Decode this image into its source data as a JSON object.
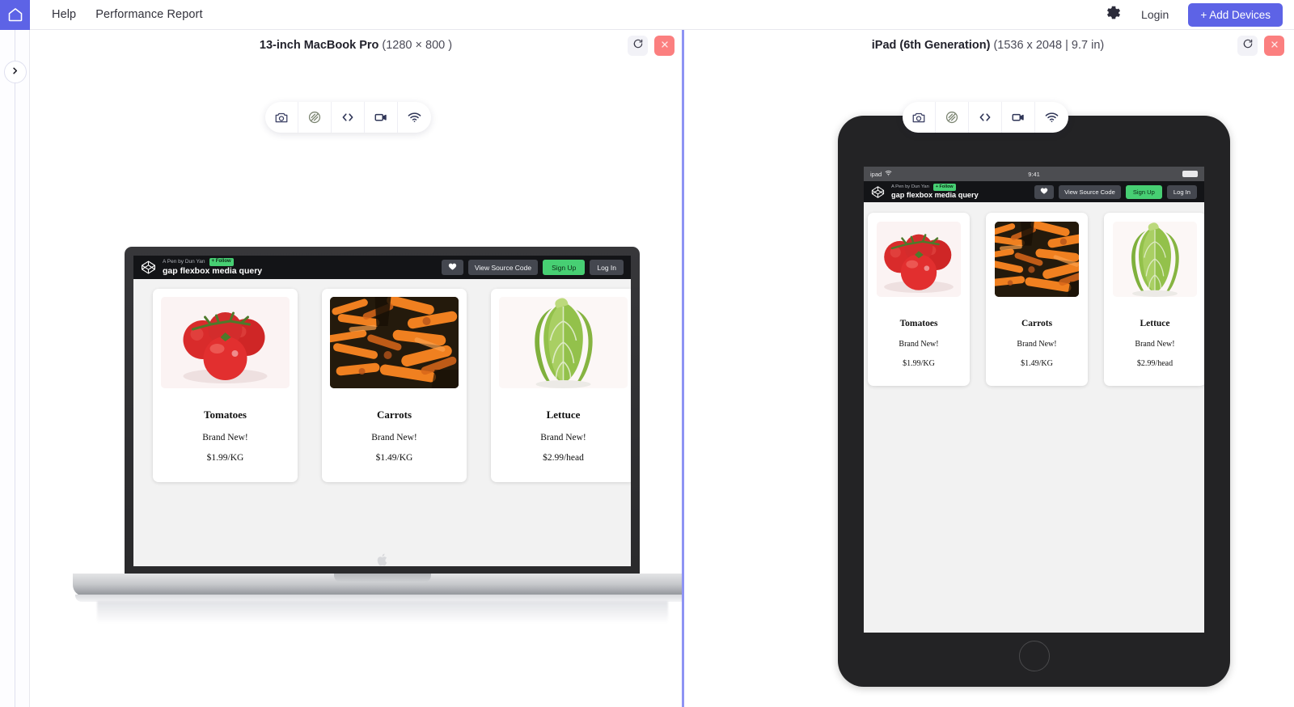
{
  "topnav": {
    "home_icon": "home-icon",
    "links": [
      {
        "label": "Help"
      },
      {
        "label": "Performance Report"
      }
    ],
    "gear_icon": "gear-icon",
    "login_label": "Login",
    "add_devices_label": "+ Add Devices",
    "accent_color": "#5d63e6"
  },
  "left_rail": {
    "toggle_icon": "chevron-right-icon"
  },
  "toolbar": {
    "items": [
      {
        "name": "screenshot-icon",
        "title": "Screenshot"
      },
      {
        "name": "disable-css-icon",
        "title": "Disable CSS"
      },
      {
        "name": "code-icon",
        "title": "Inspect code"
      },
      {
        "name": "record-video-icon",
        "title": "Record video"
      },
      {
        "name": "wifi-icon",
        "title": "Network throttling"
      }
    ]
  },
  "panels": [
    {
      "id": "macbook",
      "device_name": "13-inch MacBook Pro",
      "device_specs": "(1280 × 800 )",
      "refresh_icon": "refresh-icon",
      "close_icon": "close-icon",
      "status_bar": null
    },
    {
      "id": "ipad",
      "device_name": "iPad (6th Generation)",
      "device_specs": "(1536 x 2048 | 9.7 in)",
      "refresh_icon": "refresh-icon",
      "close_icon": "close-icon",
      "status_bar": {
        "carrier": "ipad",
        "wifi_icon": "wifi-icon",
        "time": "9:41",
        "battery_icon": "battery-icon"
      }
    }
  ],
  "embed": {
    "byline": "A Pen by Dun Yan",
    "follow_label": "+ Follow",
    "title": "gap flexbox media query",
    "heart_icon": "heart-icon",
    "buttons": [
      {
        "label": "View Source Code",
        "style": "dark"
      },
      {
        "label": "Sign Up",
        "style": "green"
      },
      {
        "label": "Log In",
        "style": "dark"
      }
    ],
    "logo_icon": "codepen-logo-icon"
  },
  "products": [
    {
      "name": "Tomatoes",
      "subtitle": "Brand New!",
      "price": "$1.99/KG",
      "art": "tomatoes-image"
    },
    {
      "name": "Carrots",
      "subtitle": "Brand New!",
      "price": "$1.49/KG",
      "art": "carrots-image"
    },
    {
      "name": "Lettuce",
      "subtitle": "Brand New!",
      "price": "$2.99/head",
      "art": "lettuce-image"
    }
  ]
}
